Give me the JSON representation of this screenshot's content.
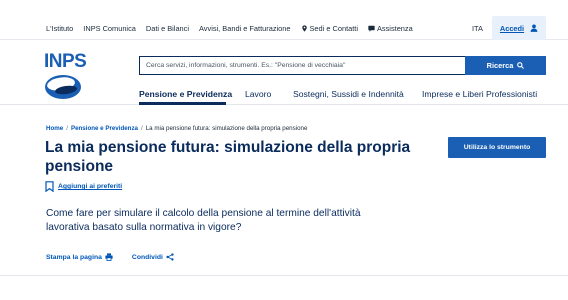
{
  "topbar": {
    "links": [
      {
        "label": "L'Istituto",
        "icon": null
      },
      {
        "label": "INPS Comunica",
        "icon": null
      },
      {
        "label": "Dati e Bilanci",
        "icon": null
      },
      {
        "label": "Avvisi, Bandi e Fatturazione",
        "icon": null
      },
      {
        "label": "Sedi e Contatti",
        "icon": "location-pin-icon"
      },
      {
        "label": "Assistenza",
        "icon": "chat-icon"
      }
    ],
    "language": "ITA",
    "login_label": "Accedi"
  },
  "header": {
    "logo_text": "INPS",
    "search_placeholder": "Cerca servizi, informazioni, strumenti. Es.: \"Pensione di vecchiaia\"",
    "search_button": "Ricerca"
  },
  "nav": {
    "tabs": [
      {
        "label": "Pensione e Previdenza",
        "active": true
      },
      {
        "label": "Lavoro",
        "active": false
      },
      {
        "label": "Sostegni, Sussidi e Indennità",
        "active": false
      },
      {
        "label": "Imprese e Liberi Professionisti",
        "active": false
      }
    ]
  },
  "breadcrumb": {
    "items": [
      "Home",
      "Pensione e Previdenza",
      "La mia pensione futura: simulazione della propria pensione"
    ]
  },
  "page": {
    "title": "La mia pensione futura: simulazione della propria pensione",
    "cta": "Utilizza lo strumento",
    "favorite": "Aggiungi ai preferiti",
    "description": "Come fare per simulare il calcolo della pensione al termine dell'attività lavorativa basato sulla normativa in vigore?",
    "print": "Stampa la pagina",
    "share": "Condividi"
  },
  "colors": {
    "primary": "#1a5fb4",
    "navy": "#0a2b5c",
    "link": "#0057b7"
  }
}
